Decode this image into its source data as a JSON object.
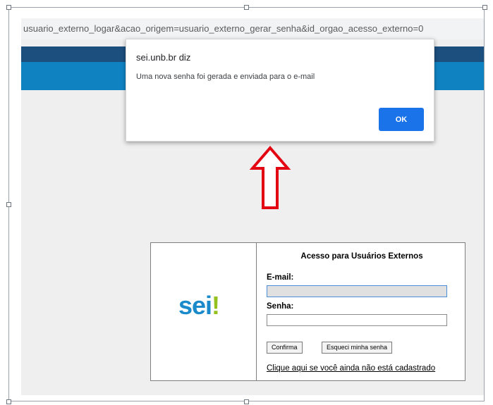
{
  "browser": {
    "url_fragment": "usuario_externo_logar&acao_origem=usuario_externo_gerar_senha&id_orgao_acesso_externo=0"
  },
  "alert": {
    "title": "sei.unb.br diz",
    "message": "Uma nova senha foi gerada e enviada para o e-mail",
    "ok_label": "OK"
  },
  "login": {
    "logo_text": "sei",
    "logo_mark": "!",
    "title": "Acesso para Usuários Externos",
    "email_label": "E-mail:",
    "email_value": "",
    "password_label": "Senha:",
    "password_value": "",
    "confirm_label": "Confirma",
    "forgot_label": "Esqueci minha senha",
    "register_link": "Clique aqui se você ainda não está cadastrado"
  },
  "colors": {
    "arrow": "#e30613",
    "logo_blue": "#1a8acb",
    "logo_green": "#95c11f",
    "ok_button": "#1a73e8"
  },
  "icons": {
    "annotation": "red-up-arrow-icon"
  }
}
